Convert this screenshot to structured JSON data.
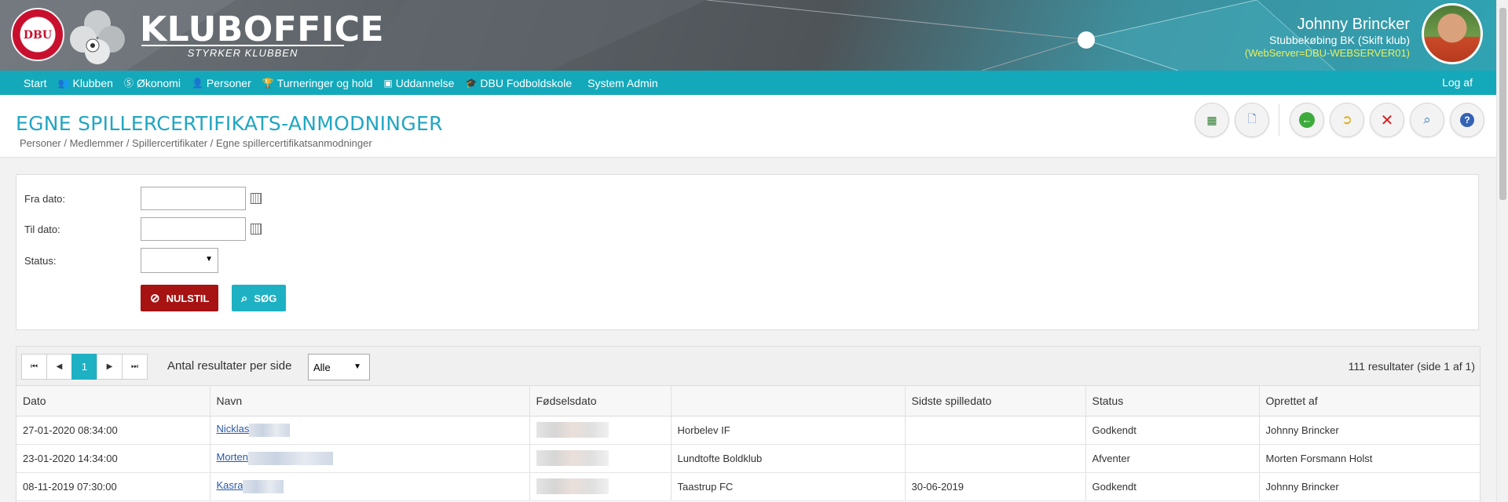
{
  "header": {
    "logo_text": "DBU",
    "brand_title": "KLUBOFFICE",
    "brand_subtitle": "STYRKER KLUBBEN",
    "user_name": "Johnny Brincker",
    "user_club": "Stubbekøbing BK (Skift klub)",
    "server_info": "(WebServer=DBU-WEBSERVER01)"
  },
  "nav": {
    "items": [
      {
        "label": "Start",
        "icon": ""
      },
      {
        "label": "Klubben",
        "icon": "people-icon"
      },
      {
        "label": "Økonomi",
        "icon": "coin-icon"
      },
      {
        "label": "Personer",
        "icon": "person-icon"
      },
      {
        "label": "Turneringer og hold",
        "icon": "trophy-icon"
      },
      {
        "label": "Uddannelse",
        "icon": "presentation-icon"
      },
      {
        "label": "DBU Fodboldskole",
        "icon": "graduation-cap-icon"
      },
      {
        "label": "System Admin",
        "icon": ""
      }
    ],
    "logout": "Log af"
  },
  "title": {
    "page_title": "EGNE SPILLERCERTIFIKATS-ANMODNINGER",
    "breadcrumb": "Personer / Medlemmer / Spillercertifikater / Egne spillercertifikatsanmodninger"
  },
  "toolbar": {
    "buttons": [
      "excel-icon",
      "document-icon",
      "back-arrow-icon",
      "open-folder-icon",
      "close-icon",
      "search-icon",
      "help-icon"
    ]
  },
  "form": {
    "from_label": "Fra dato:",
    "from_value": "",
    "to_label": "Til dato:",
    "to_value": "",
    "status_label": "Status:",
    "status_value": "",
    "reset_label": "NULSTIL",
    "search_label": "SØG"
  },
  "pager": {
    "current_page": "1",
    "per_page_label": "Antal resultater per side",
    "per_page_value": "Alle",
    "result_count": "111 resultater (side 1 af 1)"
  },
  "table": {
    "columns": [
      "Dato",
      "Navn",
      "Fødselsdato",
      "",
      "Sidste spilledato",
      "Status",
      "Oprettet af"
    ],
    "rows": [
      {
        "dato": "27-01-2020 08:34:00",
        "navn": "Nicklas",
        "fodselsdato": "",
        "klub": "Horbelev IF",
        "sidste": "",
        "status": "Godkendt",
        "oprettet": "Johnny Brincker"
      },
      {
        "dato": "23-01-2020 14:34:00",
        "navn": "Morten",
        "fodselsdato": "",
        "klub": "Lundtofte Boldklub",
        "sidste": "",
        "status": "Afventer",
        "oprettet": "Morten Forsmann Holst"
      },
      {
        "dato": "08-11-2019 07:30:00",
        "navn": "Kasra",
        "fodselsdato": "",
        "klub": "Taastrup FC",
        "sidste": "30-06-2019",
        "status": "Godkendt",
        "oprettet": "Johnny Brincker"
      }
    ]
  },
  "colors": {
    "nav_bg": "#13a9bb",
    "title_color": "#21a6c2",
    "reset_button": "#a71212",
    "search_button": "#1eb1c3",
    "server_text": "#e8f060"
  }
}
